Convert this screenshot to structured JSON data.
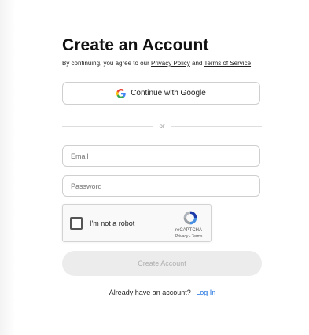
{
  "page": {
    "title": "Create an Account",
    "terms_prefix": "By continuing, you agree to our",
    "privacy_link": "Privacy Policy",
    "terms_and": "and",
    "terms_link": "Terms of Service"
  },
  "google": {
    "label": "Continue with Google",
    "icon": "google-icon"
  },
  "divider": {
    "text": "or"
  },
  "form": {
    "email_placeholder": "Email",
    "email_value": "",
    "password_placeholder": "Password",
    "password_value": ""
  },
  "recaptcha": {
    "label": "I'm not a robot",
    "brand": "reCAPTCHA",
    "links": "Privacy - Terms",
    "checked": false
  },
  "submit": {
    "label": "Create Account",
    "disabled": true
  },
  "footer": {
    "prompt": "Already have an account?",
    "link": "Log In"
  },
  "colors": {
    "link": "#1a6fe0",
    "button_bg": "#ececed",
    "border": "#cfcfcf"
  }
}
